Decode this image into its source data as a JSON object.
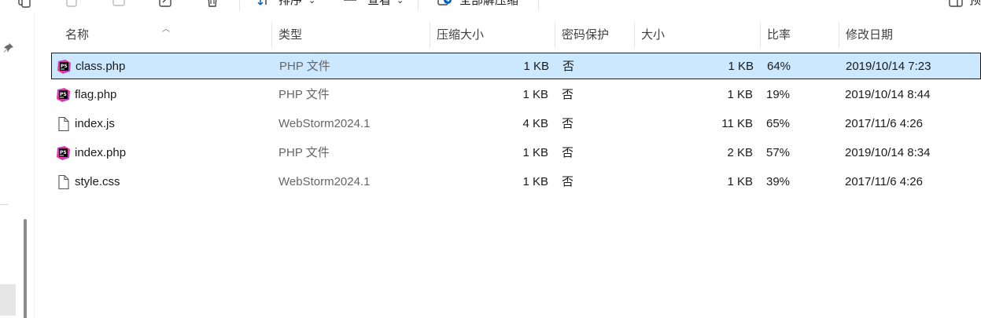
{
  "toolbar": {
    "sort_label": "排序",
    "view_label": "查看",
    "extract_all_label": "全部解压缩",
    "more_label": "···"
  },
  "columns": {
    "name": "名称",
    "type": "类型",
    "compressed_size": "压缩大小",
    "password_protected": "密码保护",
    "size": "大小",
    "ratio": "比率",
    "modified": "修改日期"
  },
  "files": [
    {
      "name": "class.php",
      "type": "PHP 文件",
      "compressed_size": "1 KB",
      "password_protected": "否",
      "size": "1 KB",
      "ratio": "64%",
      "modified": "2019/10/14 7:23",
      "icon": "phpstorm-icon",
      "selected": true
    },
    {
      "name": "flag.php",
      "type": "PHP 文件",
      "compressed_size": "1 KB",
      "password_protected": "否",
      "size": "1 KB",
      "ratio": "19%",
      "modified": "2019/10/14 8:44",
      "icon": "phpstorm-icon",
      "selected": false
    },
    {
      "name": "index.js",
      "type": "WebStorm2024.1",
      "compressed_size": "4 KB",
      "password_protected": "否",
      "size": "11 KB",
      "ratio": "65%",
      "modified": "2017/11/6 4:26",
      "icon": "blank-file-icon",
      "selected": false
    },
    {
      "name": "index.php",
      "type": "PHP 文件",
      "compressed_size": "1 KB",
      "password_protected": "否",
      "size": "2 KB",
      "ratio": "57%",
      "modified": "2019/10/14 8:34",
      "icon": "phpstorm-icon",
      "selected": false
    },
    {
      "name": "style.css",
      "type": "WebStorm2024.1",
      "compressed_size": "1 KB",
      "password_protected": "否",
      "size": "1 KB",
      "ratio": "39%",
      "modified": "2017/11/6 4:26",
      "icon": "blank-file-icon",
      "selected": false
    }
  ],
  "colors": {
    "selection_bg": "#cce8ff",
    "accent": "#005fb8",
    "muted_text": "#666666"
  }
}
